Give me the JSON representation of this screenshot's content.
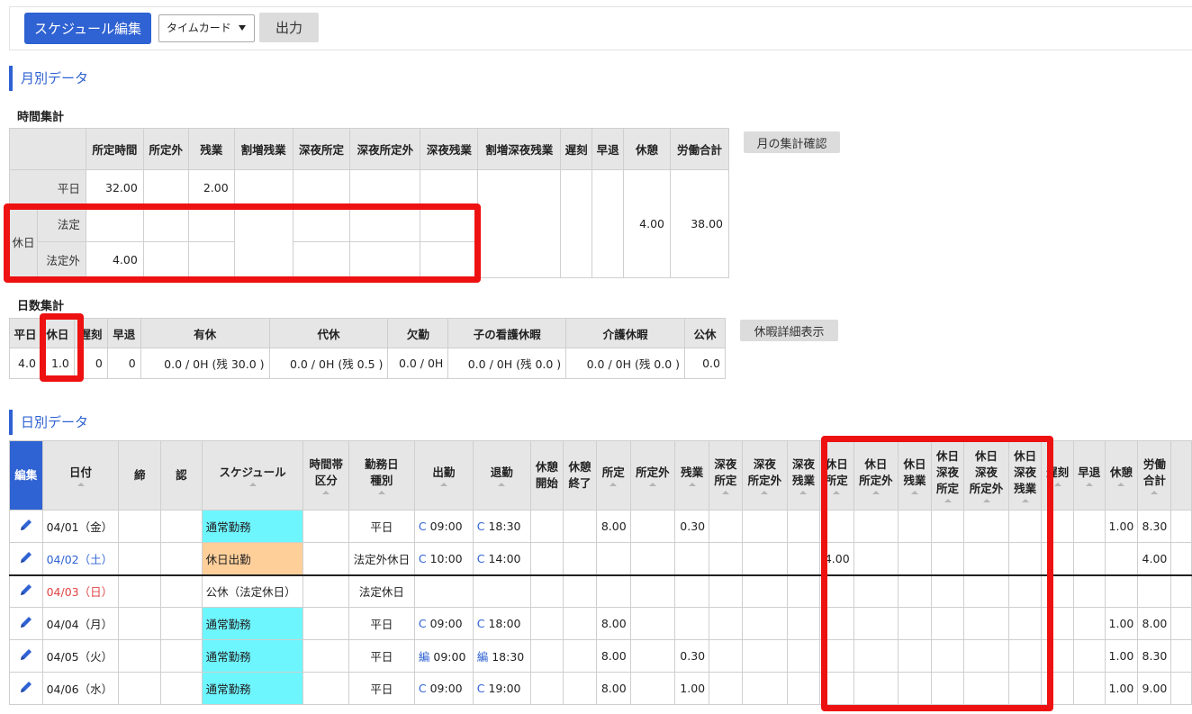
{
  "toolbar": {
    "schedule_edit": "スケジュール編集",
    "view_select": "タイムカード",
    "output": "出力"
  },
  "monthly": {
    "title": "月別データ",
    "time_title": "時間集計",
    "confirm_button": "月の集計確認",
    "headers": [
      "所定時間",
      "所定外",
      "残業",
      "割増残業",
      "深夜所定",
      "深夜所定外",
      "深夜残業",
      "割増深夜残業",
      "遅刻",
      "早退",
      "休憩",
      "労働合計"
    ],
    "row_weekday": "平日",
    "row_holiday": "休日",
    "row_legal": "法定",
    "row_nonlegal": "法定外",
    "weekday_scheduled": "32.00",
    "weekday_overtime": "2.00",
    "nonlegal_scheduled": "4.00",
    "break_total": "4.00",
    "work_total": "38.00"
  },
  "days": {
    "title": "日数集計",
    "leave_detail_button": "休暇詳細表示",
    "headers": [
      "平日",
      "休日",
      "遅刻",
      "早退",
      "有休",
      "代休",
      "欠勤",
      "子の看護休暇",
      "介護休暇",
      "公休"
    ],
    "values": [
      "4.0",
      "1.0",
      "0",
      "0",
      "0.0 / 0H (残 30.0 )",
      "0.0 / 0H (残 0.5 )",
      "0.0 / 0H",
      "0.0 / 0H (残 0.0 )",
      "0.0 / 0H (残 0.0 )",
      "0.0"
    ]
  },
  "daily": {
    "title": "日別データ",
    "headers": {
      "edit": "編集",
      "date": "日付",
      "close": "締",
      "approve": "認",
      "schedule": "スケジュール",
      "time_zone_1": "時間帯",
      "time_zone_2": "区分",
      "day_type_1": "勤務日",
      "day_type_2": "種別",
      "clock_in": "出勤",
      "clock_out": "退勤",
      "break_start_1": "休憩",
      "break_start_2": "開始",
      "break_end_1": "休憩",
      "break_end_2": "終了",
      "scheduled": "所定",
      "non_scheduled": "所定外",
      "overtime": "残業",
      "night_sched_1": "深夜",
      "night_sched_2": "所定",
      "night_nonsched_1": "深夜",
      "night_nonsched_2": "所定外",
      "night_ot_1": "深夜",
      "night_ot_2": "残業",
      "hol_sched_1": "休日",
      "hol_sched_2": "所定",
      "hol_nonsched_1": "休日",
      "hol_nonsched_2": "所定外",
      "hol_ot_1": "休日",
      "hol_ot_2": "残業",
      "hol_night_sched_1": "休日",
      "hol_night_sched_2": "深夜",
      "hol_night_sched_3": "所定",
      "hol_night_nonsched_1": "休日",
      "hol_night_nonsched_2": "深夜",
      "hol_night_nonsched_3": "所定外",
      "hol_night_ot_1": "休日",
      "hol_night_ot_2": "深夜",
      "hol_night_ot_3": "残業",
      "late": "遅刻",
      "early": "早退",
      "break": "休憩",
      "work_total_1": "労働",
      "work_total_2": "合計"
    },
    "rows": [
      {
        "date": "04/01（金）",
        "schedule": "通常勤務",
        "day_type": "平日",
        "in": "C 09:00",
        "out": "C 18:30",
        "scheduled": "8.00",
        "overtime": "0.30",
        "hol_sched": "",
        "break": "1.00",
        "total": "8.30"
      },
      {
        "date": "04/02（土）",
        "schedule": "休日出勤",
        "day_type": "法定外休日",
        "in": "C 10:00",
        "out": "C 14:00",
        "scheduled": "",
        "overtime": "",
        "hol_sched": "4.00",
        "break": "",
        "total": "4.00"
      },
      {
        "date": "04/03（日）",
        "schedule": "公休（法定休日）",
        "day_type": "法定休日",
        "in": "",
        "out": "",
        "scheduled": "",
        "overtime": "",
        "hol_sched": "",
        "break": "",
        "total": ""
      },
      {
        "date": "04/04（月）",
        "schedule": "通常勤務",
        "day_type": "平日",
        "in": "C 09:00",
        "out": "C 18:00",
        "scheduled": "8.00",
        "overtime": "",
        "hol_sched": "",
        "break": "1.00",
        "total": "8.00"
      },
      {
        "date": "04/05（火）",
        "schedule": "通常勤務",
        "day_type": "平日",
        "in": "編 09:00",
        "out": "編 18:30",
        "scheduled": "8.00",
        "overtime": "0.30",
        "hol_sched": "",
        "break": "1.00",
        "total": "8.30"
      },
      {
        "date": "04/06（水）",
        "schedule": "通常勤務",
        "day_type": "平日",
        "in": "C 09:00",
        "out": "C 19:00",
        "scheduled": "8.00",
        "overtime": "1.00",
        "hol_sched": "",
        "break": "1.00",
        "total": "9.00"
      }
    ]
  },
  "colors": {
    "accent": "#2f62d2",
    "highlight": "#ee1111",
    "schedule_normal": "#6ef6ff",
    "schedule_holiday_work": "#ffcf9a"
  }
}
